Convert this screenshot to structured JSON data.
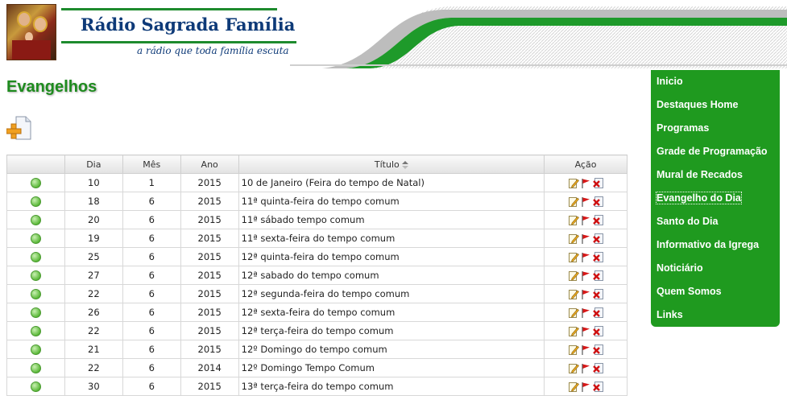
{
  "site": {
    "title": "Rádio Sagrada Família",
    "tagline": "a rádio que toda família escuta"
  },
  "page_title": "Evangelhos",
  "table": {
    "headers": {
      "status": "",
      "dia": "Dia",
      "mes": "Mês",
      "ano": "Ano",
      "titulo": "Título",
      "acao": "Ação"
    },
    "rows": [
      {
        "dia": "10",
        "mes": "1",
        "ano": "2015",
        "titulo": "10 de Janeiro (Feira do tempo de Natal)"
      },
      {
        "dia": "18",
        "mes": "6",
        "ano": "2015",
        "titulo": "11ª quinta-feira do tempo comum"
      },
      {
        "dia": "20",
        "mes": "6",
        "ano": "2015",
        "titulo": "11ª sábado tempo comum"
      },
      {
        "dia": "19",
        "mes": "6",
        "ano": "2015",
        "titulo": "11ª sexta-feira do tempo comum"
      },
      {
        "dia": "25",
        "mes": "6",
        "ano": "2015",
        "titulo": "12ª quinta-feira do tempo comum"
      },
      {
        "dia": "27",
        "mes": "6",
        "ano": "2015",
        "titulo": "12ª sabado do tempo comum"
      },
      {
        "dia": "22",
        "mes": "6",
        "ano": "2015",
        "titulo": "12ª segunda-feira do tempo comum"
      },
      {
        "dia": "26",
        "mes": "6",
        "ano": "2015",
        "titulo": "12ª sexta-feira do tempo comum"
      },
      {
        "dia": "22",
        "mes": "6",
        "ano": "2015",
        "titulo": "12ª terça-feira do tempo comum"
      },
      {
        "dia": "21",
        "mes": "6",
        "ano": "2015",
        "titulo": "12º Domingo do tempo comum"
      },
      {
        "dia": "22",
        "mes": "6",
        "ano": "2014",
        "titulo": "12º Domingo Tempo Comum"
      },
      {
        "dia": "30",
        "mes": "6",
        "ano": "2015",
        "titulo": "13ª terça-feira do tempo comum"
      }
    ]
  },
  "nav": {
    "items": [
      {
        "label": "Inicio"
      },
      {
        "label": "Destaques Home"
      },
      {
        "label": "Programas"
      },
      {
        "label": "Grade de Programação"
      },
      {
        "label": "Mural de Recados"
      },
      {
        "label": "Evangelho do Dia",
        "active": true
      },
      {
        "label": "Santo do Dia"
      },
      {
        "label": "Informativo da Igrega"
      },
      {
        "label": "Noticiário"
      },
      {
        "label": "Quem Somos"
      },
      {
        "label": "Links"
      }
    ]
  },
  "colors": {
    "accent_green": "#1f9a1f",
    "title_blue": "#0e3a78",
    "page_title_green": "#1e8b1e"
  },
  "icons": {
    "add": "add-document-icon",
    "status": "status-green-dot-icon",
    "edit": "edit-pencil-icon",
    "flag": "red-flag-icon",
    "delete": "delete-x-icon",
    "sort": "sort-arrows-icon"
  }
}
